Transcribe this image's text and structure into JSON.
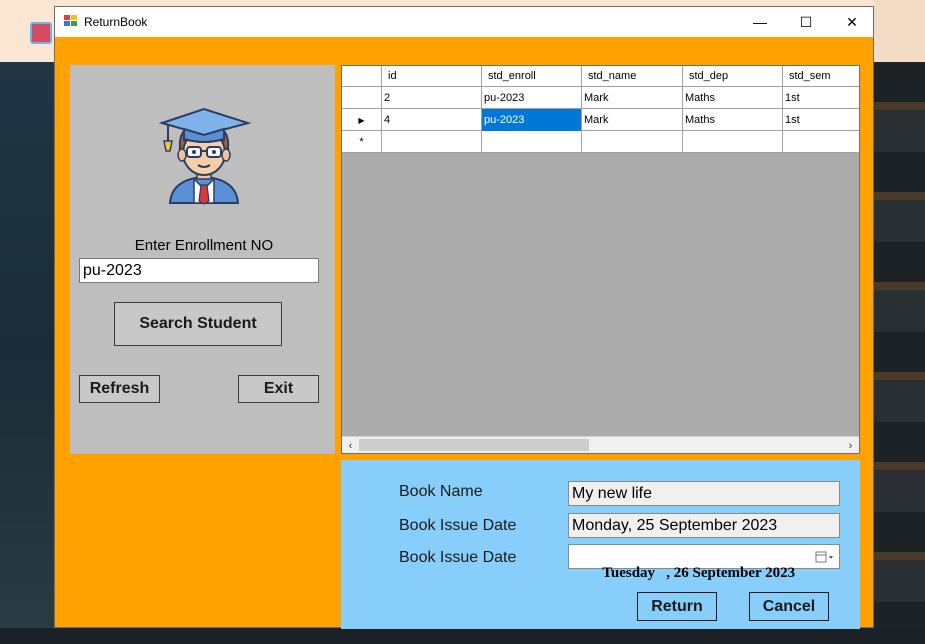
{
  "window": {
    "title": "ReturnBook",
    "minimize": "—",
    "maximize": "☐",
    "close": "✕"
  },
  "left_panel": {
    "enroll_label": "Enter Enrollment NO",
    "enroll_value": "pu-2023",
    "search_button": "Search Student",
    "refresh_button": "Refresh",
    "exit_button": "Exit"
  },
  "grid": {
    "columns": [
      "id",
      "std_enroll",
      "std_name",
      "std_dep",
      "std_sem"
    ],
    "rows": [
      [
        "2",
        "pu-2023",
        "Mark",
        "Maths",
        "1st"
      ],
      [
        "4",
        "pu-2023",
        "Mark",
        "Maths",
        "1st"
      ]
    ],
    "current_row_marker": "▶",
    "new_row_marker": "*",
    "scroll_left": "‹",
    "scroll_right": "›"
  },
  "form": {
    "book_name_label": "Book Name",
    "book_name_value": "My new life",
    "issue_date_label": "Book Issue Date",
    "issue_date_value": "Monday, 25 September 2023",
    "return_date_label": "Book Issue Date",
    "return_date_value": "Tuesday   , 26 September 2023",
    "return_button": "Return",
    "cancel_button": "Cancel"
  },
  "colors": {
    "window_bg": "#ffa200",
    "left_panel_bg": "#bebebe",
    "grid_bg": "#ababab",
    "form_bg": "#87cefa",
    "selection": "#0078d7"
  },
  "icons": {
    "app": "app-window-icon",
    "avatar": "graduate-student-icon",
    "calendar": "calendar-dropdown-icon"
  }
}
